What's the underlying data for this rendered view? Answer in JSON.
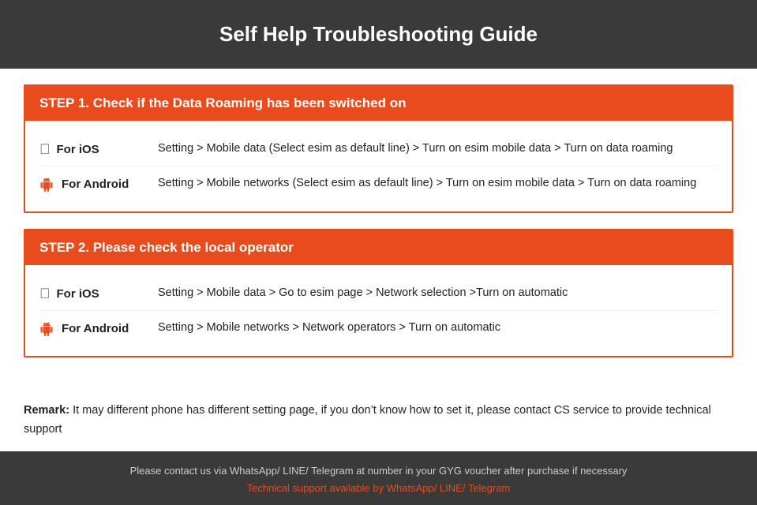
{
  "header": {
    "title": "Self Help Troubleshooting Guide"
  },
  "step1": {
    "heading": "STEP 1.  Check if the Data Roaming has been switched on",
    "ios": {
      "label": "For iOS",
      "text": "Setting > Mobile data (Select esim as default line) > Turn on esim mobile data > Turn on data roaming"
    },
    "android": {
      "label": "For Android",
      "text": "Setting > Mobile networks (Select esim as default line) > Turn on esim mobile data > Turn on data roaming"
    }
  },
  "step2": {
    "heading": "STEP 2.  Please check the local operator",
    "ios": {
      "label": "For iOS",
      "text": "Setting > Mobile data > Go to esim page > Network selection >Turn on automatic"
    },
    "android": {
      "label": "For Android",
      "text": "Setting > Mobile networks > Network operators > Turn on automatic"
    }
  },
  "remark": {
    "label": "Remark:",
    "text": "It may different phone has different setting page, if you don’t know how to set it,  please contact CS service to provide technical support"
  },
  "footer": {
    "line1": "Please contact us via WhatsApp/ LINE/ Telegram at number in your GYG voucher after purchase if necessary",
    "line2": "Technical support available by WhatsApp/ LINE/ Telegram"
  }
}
